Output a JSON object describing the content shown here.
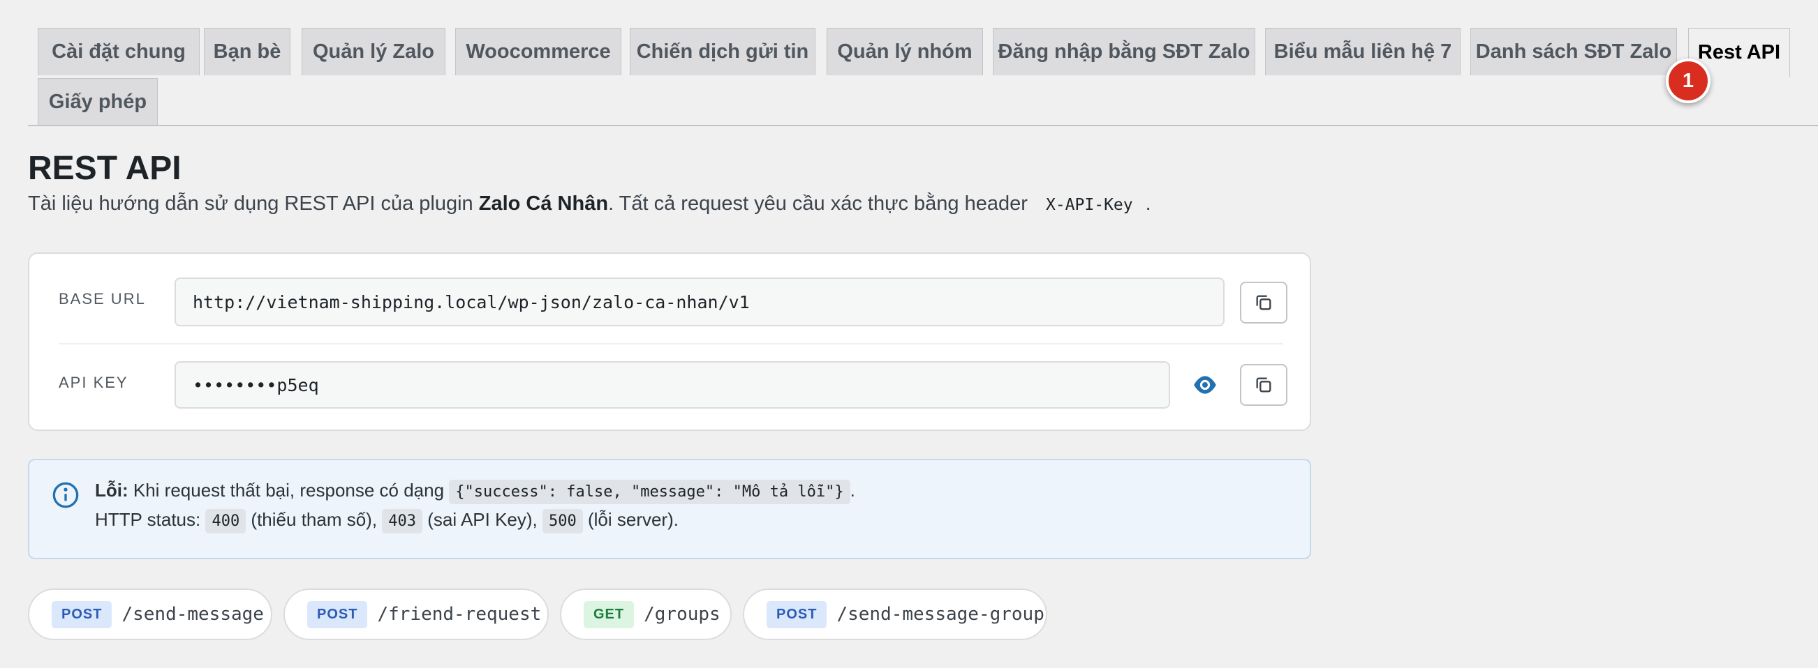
{
  "tabs": [
    {
      "label": "Cài đặt chung"
    },
    {
      "label": "Bạn bè"
    },
    {
      "label": "Quản lý Zalo"
    },
    {
      "label": "Woocommerce"
    },
    {
      "label": "Chiến dịch gửi tin"
    },
    {
      "label": "Quản lý nhóm"
    },
    {
      "label": "Đăng nhập bằng SĐT Zalo"
    },
    {
      "label": "Biểu mẫu liên hệ 7"
    },
    {
      "label": "Danh sách SĐT Zalo"
    },
    {
      "label": "Rest API",
      "active": true
    },
    {
      "label": "Giấy phép"
    }
  ],
  "badge": "1",
  "page": {
    "title": "REST API",
    "desc_prefix": "Tài liệu hướng dẫn sử dụng REST API của plugin ",
    "desc_plugin": "Zalo Cá Nhân",
    "desc_mid": ". Tất cả request yêu cầu xác thực bằng header ",
    "desc_header": "X-API-Key",
    "desc_suffix": "."
  },
  "config": {
    "base_url_label": "BASE URL",
    "base_url": "http://vietnam-shipping.local/wp-json/zalo-ca-nhan/v1",
    "api_key_label": "API KEY",
    "api_key": "••••••••p5eq"
  },
  "error_info": {
    "title": "Lỗi:",
    "line1_text": " Khi request thất bại, response có dạng ",
    "line1_code": "{\"success\": false, \"message\": \"Mô tả lỗi\"}",
    "line1_end": ".",
    "line2_prefix": "HTTP status: ",
    "status1": "400",
    "status1_desc": " (thiếu tham số), ",
    "status2": "403",
    "status2_desc": " (sai API Key), ",
    "status3": "500",
    "status3_desc": " (lỗi server)."
  },
  "endpoints": [
    {
      "method": "POST",
      "path": "/send-message"
    },
    {
      "method": "POST",
      "path": "/friend-request"
    },
    {
      "method": "GET",
      "path": "/groups"
    },
    {
      "method": "POST",
      "path": "/send-message-group"
    }
  ],
  "colors": {
    "badge": "#d92d20",
    "post": "#2b5bb5",
    "get": "#1e7b3c",
    "eye": "#2271b1"
  }
}
